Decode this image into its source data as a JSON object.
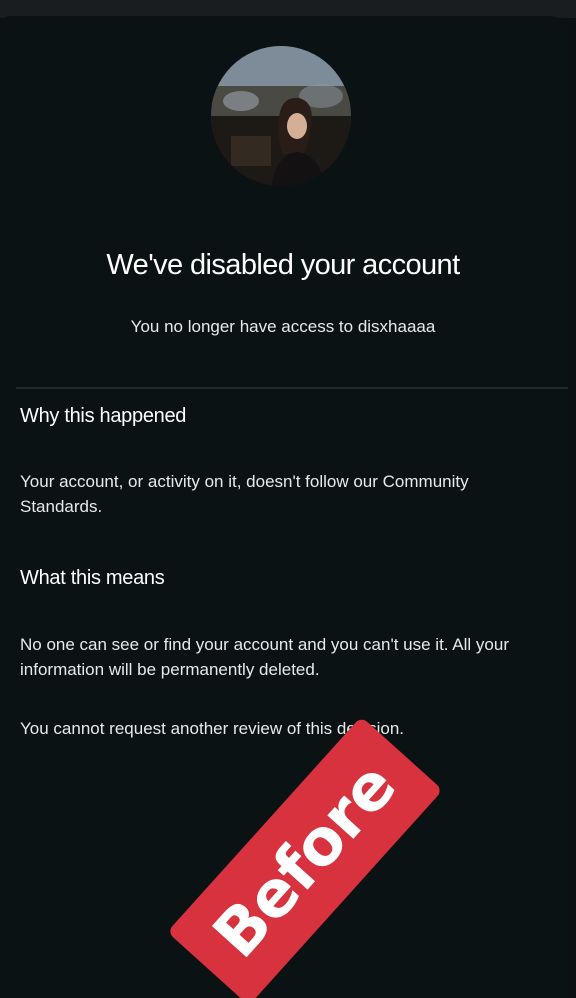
{
  "header": {
    "title": "We've disabled your account",
    "subtitle": "You no longer have access to disxhaaaa"
  },
  "sections": [
    {
      "heading": "Why this happened",
      "paragraphs": [
        "Your account, or activity on it, doesn't follow our Community Standards."
      ]
    },
    {
      "heading": "What this means",
      "paragraphs": [
        "No one can see or find your account and you can't use it. All your information will be permanently deleted.",
        "You cannot request another review of this decision."
      ]
    }
  ],
  "stamp": {
    "label": "Before",
    "color": "#d8323f"
  },
  "colors": {
    "background": "#0b1214",
    "text": "#ffffff"
  }
}
